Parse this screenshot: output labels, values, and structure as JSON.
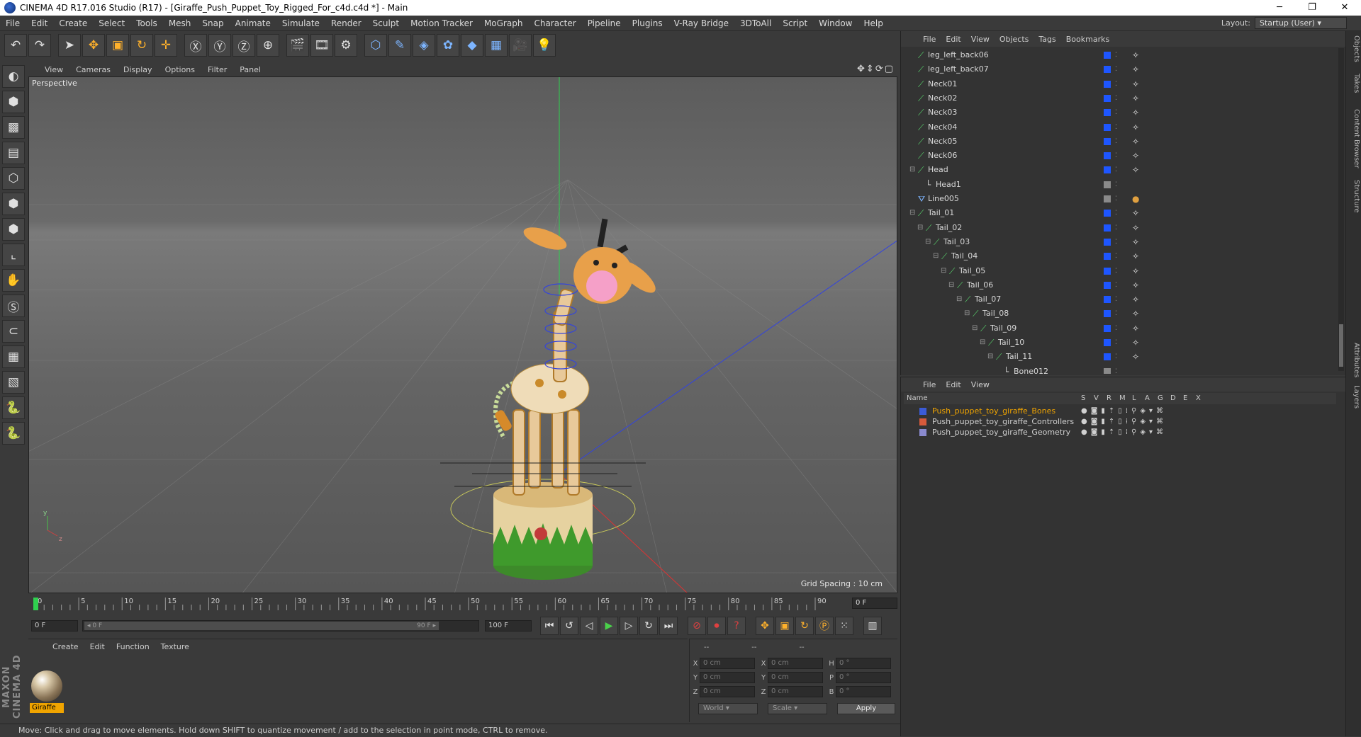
{
  "window": {
    "title": "CINEMA 4D R17.016 Studio (R17) - [Giraffe_Push_Puppet_Toy_Rigged_For_c4d.c4d *] - Main",
    "min": "─",
    "max": "❐",
    "close": "✕"
  },
  "menubar": {
    "items": [
      "File",
      "Edit",
      "Create",
      "Select",
      "Tools",
      "Mesh",
      "Snap",
      "Animate",
      "Simulate",
      "Render",
      "Sculpt",
      "Motion Tracker",
      "MoGraph",
      "Character",
      "Pipeline",
      "Plugins",
      "V-Ray Bridge",
      "3DToAll",
      "Script",
      "Window",
      "Help"
    ],
    "layout_label": "Layout:",
    "layout_value": "Startup (User)"
  },
  "toolbar": {
    "icons": [
      "undo-icon",
      "redo-icon",
      "select-arrow-icon",
      "move-icon",
      "scale-icon",
      "rotate-icon",
      "add-icon",
      "x-axis-icon",
      "y-axis-icon",
      "z-axis-icon",
      "world-coords-icon",
      "render-view-icon",
      "render-picture-viewer-icon",
      "render-settings-icon",
      "cube-icon",
      "pen-icon",
      "subdivision-icon",
      "array-icon",
      "deformer-icon",
      "floor-icon",
      "camera-icon",
      "light-icon"
    ],
    "glyphs": [
      "↶",
      "↷",
      "➤",
      "✥",
      "▣",
      "↻",
      "✛",
      "Ⓧ",
      "Ⓨ",
      "Ⓩ",
      "⊕",
      "🎬",
      "🎞",
      "⚙",
      "⬡",
      "✎",
      "◈",
      "✿",
      "◆",
      "▦",
      "🎥",
      "💡"
    ]
  },
  "lefttools": {
    "icons": [
      "model-mode-icon",
      "object-mode-icon",
      "texture-mode-icon",
      "workplane-icon",
      "points-mode-icon",
      "edges-mode-icon",
      "polygons-mode-icon",
      "axis-mode-icon",
      "tweak-icon",
      "soft-selection-icon",
      "magnet-icon",
      "lock-grid-icon",
      "snap-grid-icon",
      "python-icon",
      "python-script-icon"
    ],
    "glyphs": [
      "◐",
      "⬢",
      "▩",
      "▤",
      "⬡",
      "⬢",
      "⬢",
      "⌞",
      "✋",
      "Ⓢ",
      "⊂",
      "▦",
      "▧",
      "🐍",
      "🐍"
    ],
    "brand": "MAXON CINEMA 4D"
  },
  "viewport": {
    "menu": [
      "View",
      "Cameras",
      "Display",
      "Options",
      "Filter",
      "Panel"
    ],
    "label": "Perspective",
    "grid_spacing": "Grid Spacing : 10 cm",
    "axis_y": "y",
    "axis_z": "z"
  },
  "timeline": {
    "ticks": [
      "0",
      "5",
      "10",
      "15",
      "20",
      "25",
      "30",
      "35",
      "40",
      "45",
      "50",
      "55",
      "60",
      "65",
      "70",
      "75",
      "80",
      "85",
      "90"
    ],
    "current_frame": "0 F",
    "start_field": "0 F",
    "range_start": "◂ 0 F",
    "range_end": "90 F ▸",
    "end_field": "100 F",
    "transport_icons": [
      "go-start-icon",
      "prev-key-icon",
      "prev-frame-icon",
      "play-icon",
      "next-frame-icon",
      "next-key-icon",
      "go-end-icon",
      "record-icon",
      "autokey-icon",
      "keyframe-help-icon",
      "pos-key-icon",
      "scale-key-icon",
      "rot-key-icon",
      "param-key-icon",
      "pla-key-icon",
      "timeline-icon"
    ],
    "transport_glyphs": [
      "⏮",
      "↺",
      "◁",
      "▶",
      "▷",
      "↻",
      "⏭",
      "⊘",
      "⏺",
      "?",
      "✥",
      "▣",
      "↻",
      "Ⓟ",
      "⁙",
      "▥"
    ]
  },
  "materials": {
    "menu": [
      "Create",
      "Edit",
      "Function",
      "Texture"
    ],
    "items": [
      {
        "name": "Giraffe"
      }
    ]
  },
  "coords": {
    "headers": [
      "--",
      "--",
      "--"
    ],
    "rows": [
      {
        "a": "X",
        "av": "0 cm",
        "b": "X",
        "bv": "0 cm",
        "c": "H",
        "cv": "0 °"
      },
      {
        "a": "Y",
        "av": "0 cm",
        "b": "Y",
        "bv": "0 cm",
        "c": "P",
        "cv": "0 °"
      },
      {
        "a": "Z",
        "av": "0 cm",
        "b": "Z",
        "bv": "0 cm",
        "c": "B",
        "cv": "0 °"
      }
    ],
    "world": "World",
    "scale": "Scale",
    "apply": "Apply"
  },
  "status": "Move: Click and drag to move elements. Hold down SHIFT to quantize movement / add to the selection in point mode, CTRL to remove.",
  "objects": {
    "menu": [
      "File",
      "Edit",
      "View",
      "Objects",
      "Tags",
      "Bookmarks"
    ],
    "rows": [
      {
        "name": "leg_left_back06",
        "depth": 0,
        "tree": "",
        "type": "bone",
        "sq": "blue"
      },
      {
        "name": "leg_left_back07",
        "depth": 0,
        "tree": "",
        "type": "bone",
        "sq": "blue"
      },
      {
        "name": "Neck01",
        "depth": 0,
        "tree": "",
        "type": "bone",
        "sq": "blue"
      },
      {
        "name": "Neck02",
        "depth": 0,
        "tree": "",
        "type": "bone",
        "sq": "blue"
      },
      {
        "name": "Neck03",
        "depth": 0,
        "tree": "",
        "type": "bone",
        "sq": "blue"
      },
      {
        "name": "Neck04",
        "depth": 0,
        "tree": "",
        "type": "bone",
        "sq": "blue"
      },
      {
        "name": "Neck05",
        "depth": 0,
        "tree": "",
        "type": "bone",
        "sq": "blue"
      },
      {
        "name": "Neck06",
        "depth": 0,
        "tree": "",
        "type": "bone",
        "sq": "blue"
      },
      {
        "name": "Head",
        "depth": 0,
        "tree": "⊟",
        "type": "bone",
        "sq": "blue"
      },
      {
        "name": "Head1",
        "depth": 1,
        "tree": "",
        "type": "null",
        "sq": "grey"
      },
      {
        "name": "Line005",
        "depth": 0,
        "tree": "",
        "type": "spline",
        "sq": "grey"
      },
      {
        "name": "Tail_01",
        "depth": 0,
        "tree": "⊟",
        "type": "bone",
        "sq": "blue"
      },
      {
        "name": "Tail_02",
        "depth": 1,
        "tree": "⊟",
        "type": "bone",
        "sq": "blue"
      },
      {
        "name": "Tail_03",
        "depth": 2,
        "tree": "⊟",
        "type": "bone",
        "sq": "blue"
      },
      {
        "name": "Tail_04",
        "depth": 3,
        "tree": "⊟",
        "type": "bone",
        "sq": "blue"
      },
      {
        "name": "Tail_05",
        "depth": 4,
        "tree": "⊟",
        "type": "bone",
        "sq": "blue"
      },
      {
        "name": "Tail_06",
        "depth": 5,
        "tree": "⊟",
        "type": "bone",
        "sq": "blue"
      },
      {
        "name": "Tail_07",
        "depth": 6,
        "tree": "⊟",
        "type": "bone",
        "sq": "blue"
      },
      {
        "name": "Tail_08",
        "depth": 7,
        "tree": "⊟",
        "type": "bone",
        "sq": "blue"
      },
      {
        "name": "Tail_09",
        "depth": 8,
        "tree": "⊟",
        "type": "bone",
        "sq": "blue"
      },
      {
        "name": "Tail_10",
        "depth": 9,
        "tree": "⊟",
        "type": "bone",
        "sq": "blue"
      },
      {
        "name": "Tail_11",
        "depth": 10,
        "tree": "⊟",
        "type": "bone",
        "sq": "blue"
      },
      {
        "name": "Bone012",
        "depth": 11,
        "tree": "",
        "type": "null",
        "sq": "grey"
      }
    ]
  },
  "layers": {
    "menu": [
      "File",
      "Edit",
      "View"
    ],
    "columns": [
      "Name",
      "S",
      "V",
      "R",
      "M",
      "L",
      "A",
      "G",
      "D",
      "E",
      "X"
    ],
    "rows": [
      {
        "name": "Push_puppet_toy_giraffe_Bones",
        "color": "#3b5bd6",
        "text_color": "#f0a400"
      },
      {
        "name": "Push_puppet_toy_giraffe_Controllers",
        "color": "#d65a3b",
        "text_color": "#cfcfcf"
      },
      {
        "name": "Push_puppet_toy_giraffe_Geometry",
        "color": "#8a8acf",
        "text_color": "#cfcfcf"
      }
    ]
  },
  "sidetabs": [
    "Objects",
    "Takes",
    "Content Browser",
    "Structure",
    "Attributes",
    "Layers"
  ]
}
